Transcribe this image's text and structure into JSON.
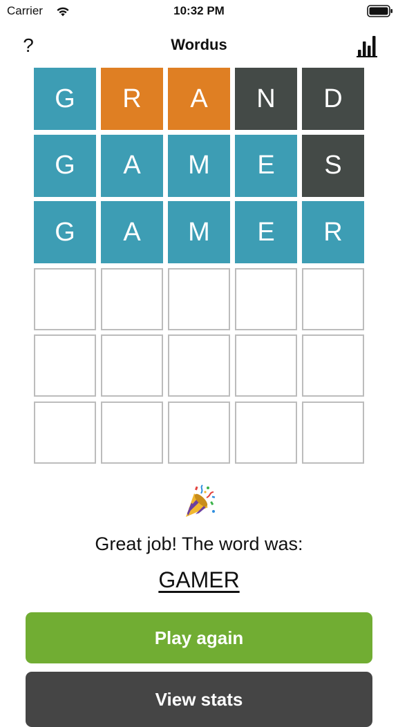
{
  "status_bar": {
    "carrier": "Carrier",
    "time": "10:32 PM",
    "wifi_icon": "wifi-icon",
    "battery_icon": "battery-icon"
  },
  "nav": {
    "help_label": "?",
    "title": "Wordus",
    "stats_icon": "bar-chart-icon"
  },
  "colors": {
    "correct": "#3d9db4",
    "present": "#df7f23",
    "absent": "#444a47",
    "empty_border": "#bcbcbc",
    "play_button": "#71ad33",
    "stats_button": "#454545"
  },
  "board": {
    "rows": [
      {
        "tiles": [
          {
            "letter": "G",
            "state": "correct"
          },
          {
            "letter": "R",
            "state": "present"
          },
          {
            "letter": "A",
            "state": "present"
          },
          {
            "letter": "N",
            "state": "absent"
          },
          {
            "letter": "D",
            "state": "absent"
          }
        ]
      },
      {
        "tiles": [
          {
            "letter": "G",
            "state": "correct"
          },
          {
            "letter": "A",
            "state": "correct"
          },
          {
            "letter": "M",
            "state": "correct"
          },
          {
            "letter": "E",
            "state": "correct"
          },
          {
            "letter": "S",
            "state": "absent"
          }
        ]
      },
      {
        "tiles": [
          {
            "letter": "G",
            "state": "correct"
          },
          {
            "letter": "A",
            "state": "correct"
          },
          {
            "letter": "M",
            "state": "correct"
          },
          {
            "letter": "E",
            "state": "correct"
          },
          {
            "letter": "R",
            "state": "correct"
          }
        ]
      },
      {
        "tiles": [
          {
            "letter": "",
            "state": "empty"
          },
          {
            "letter": "",
            "state": "empty"
          },
          {
            "letter": "",
            "state": "empty"
          },
          {
            "letter": "",
            "state": "empty"
          },
          {
            "letter": "",
            "state": "empty"
          }
        ]
      },
      {
        "tiles": [
          {
            "letter": "",
            "state": "empty"
          },
          {
            "letter": "",
            "state": "empty"
          },
          {
            "letter": "",
            "state": "empty"
          },
          {
            "letter": "",
            "state": "empty"
          },
          {
            "letter": "",
            "state": "empty"
          }
        ]
      },
      {
        "tiles": [
          {
            "letter": "",
            "state": "empty"
          },
          {
            "letter": "",
            "state": "empty"
          },
          {
            "letter": "",
            "state": "empty"
          },
          {
            "letter": "",
            "state": "empty"
          },
          {
            "letter": "",
            "state": "empty"
          }
        ]
      }
    ]
  },
  "result": {
    "icon": "party-popper-icon",
    "message": "Great job! The word was:",
    "answer": "GAMER"
  },
  "buttons": {
    "play_again": "Play again",
    "view_stats": "View stats"
  }
}
